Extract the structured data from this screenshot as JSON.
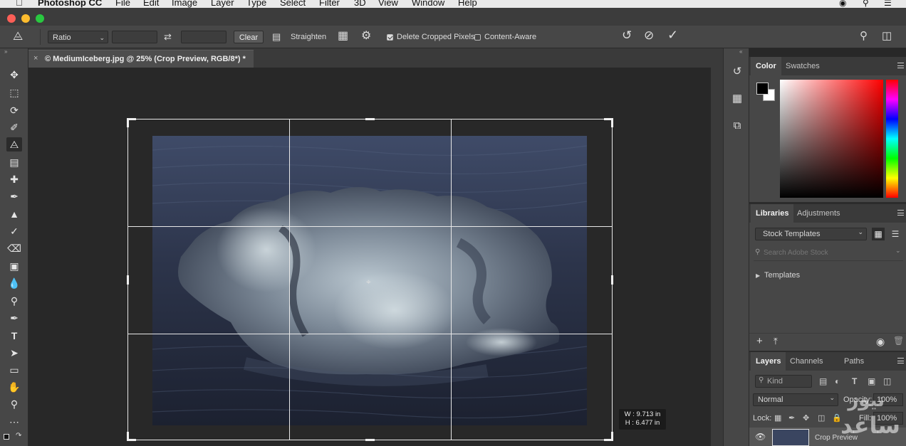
{
  "menubar": {
    "apple": "",
    "app_name": "Photoshop CC",
    "items": [
      "File",
      "Edit",
      "Image",
      "Layer",
      "Type",
      "Select",
      "Filter",
      "3D",
      "View",
      "Window",
      "Help"
    ]
  },
  "options": {
    "ratio_value": "Ratio",
    "width_value": "",
    "height_value": "",
    "clear_label": "Clear",
    "straighten_label": "Straighten",
    "delete_cropped_label": "Delete Cropped Pixels",
    "delete_cropped_checked": true,
    "content_aware_label": "Content-Aware",
    "content_aware_checked": false
  },
  "document": {
    "tab_title": "© MediumIceberg.jpg @ 25% (Crop Preview, RGB/8*) *",
    "crop_width": "W : 9.713 in",
    "crop_height": "H : 6.477 in"
  },
  "color_panel": {
    "tabs": [
      "Color",
      "Swatches"
    ],
    "active_tab": "Color",
    "foreground": "#000000",
    "background": "#ffffff",
    "hue": "#ff0000"
  },
  "libraries_panel": {
    "tabs": [
      "Libraries",
      "Adjustments"
    ],
    "library_select": "Stock Templates",
    "search_placeholder": "Search Adobe Stock",
    "templates_label": "Templates"
  },
  "layers_panel": {
    "tabs": [
      "Layers",
      "Channels",
      "Paths"
    ],
    "kind_placeholder": "Kind",
    "blend_mode": "Normal",
    "opacity_label": "Opacity:",
    "opacity_value": "100%",
    "lock_label": "Lock:",
    "fill_label": "Fill:",
    "fill_value": "100%",
    "layer_name": "Crop Preview"
  },
  "watermark": {
    "line1": "نیوز",
    "line2": "ساعد"
  }
}
